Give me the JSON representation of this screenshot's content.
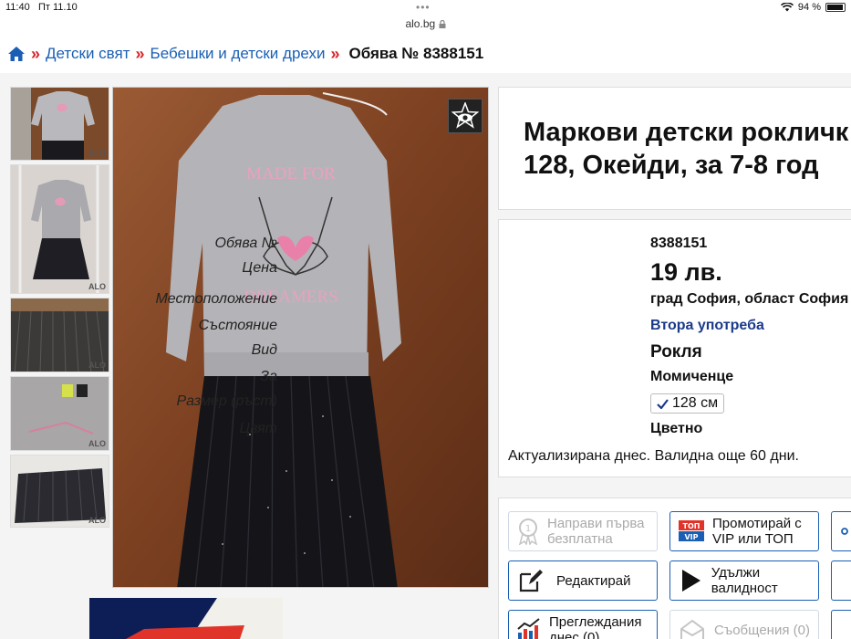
{
  "status": {
    "time": "11:40",
    "date": "Пт 11.10",
    "battery": "94 %"
  },
  "url": "alo.bg",
  "breadcrumb": {
    "items": [
      "Детски свят",
      "Бебешки и детски дрехи"
    ],
    "current": "Обява № 8388151"
  },
  "thumbs_watermark": "ALO",
  "title": {
    "line1": "Маркови детски рокличк",
    "line2": "128, Окейди, за 7-8 год"
  },
  "details": [
    {
      "label": "Обява №",
      "value": "8388151"
    },
    {
      "label": "Цена",
      "value": "19 лв."
    },
    {
      "label": "Местоположение",
      "value": "град София, област София"
    },
    {
      "label": "Състояние",
      "value": "Втора употреба"
    },
    {
      "label": "Вид",
      "value": "Рокля"
    },
    {
      "label": "За",
      "value": "Момиченце"
    },
    {
      "label": "Размер (ръст)",
      "value": "128 см"
    },
    {
      "label": "Цвят",
      "value": "Цветно"
    }
  ],
  "updated": "Актуализирана днес. Валидна още 60 дни.",
  "actions": {
    "first_free": "Направи първа безплатна",
    "promote": "Промотирай с VIP или ТОП",
    "promote_badge_top": "ТОП",
    "promote_badge_vip": "VIP",
    "edit": "Редактирай",
    "extend": "Удължи валидност",
    "views": "Преглеждания днес (0)",
    "messages": "Съобщения (0)"
  },
  "photo_print": {
    "top": "MADE FOR",
    "bottom": "DREAMERS"
  },
  "colors": {
    "link": "#1a5fb4",
    "separator": "#d8232a",
    "accent_blue": "#1a3a8a"
  }
}
